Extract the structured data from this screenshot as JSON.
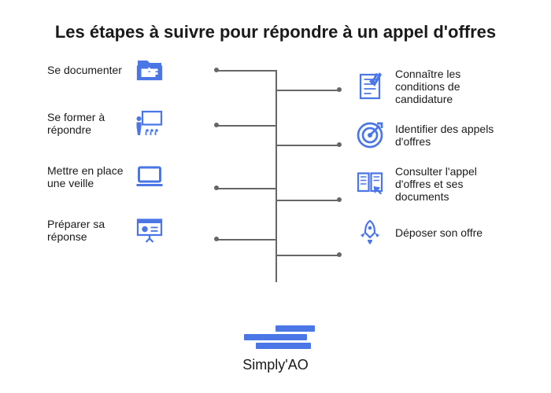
{
  "title": "Les étapes à suivre pour répondre à un appel d'offres",
  "left": [
    {
      "label": "Se documenter",
      "icon": "folder-icon"
    },
    {
      "label": "Se former à répondre",
      "icon": "training-icon"
    },
    {
      "label": "Mettre en place une veille",
      "icon": "laptop-icon"
    },
    {
      "label": "Préparer sa réponse",
      "icon": "presentation-icon"
    }
  ],
  "right": [
    {
      "label": "Connaître les conditions de candidature",
      "icon": "checklist-icon"
    },
    {
      "label": "Identifier des appels d'offres",
      "icon": "target-icon"
    },
    {
      "label": "Consulter l'appel d'offres et ses documents",
      "icon": "book-click-icon"
    },
    {
      "label": "Déposer son offre",
      "icon": "rocket-icon"
    }
  ],
  "footer": {
    "brand": "Simply'AO"
  }
}
